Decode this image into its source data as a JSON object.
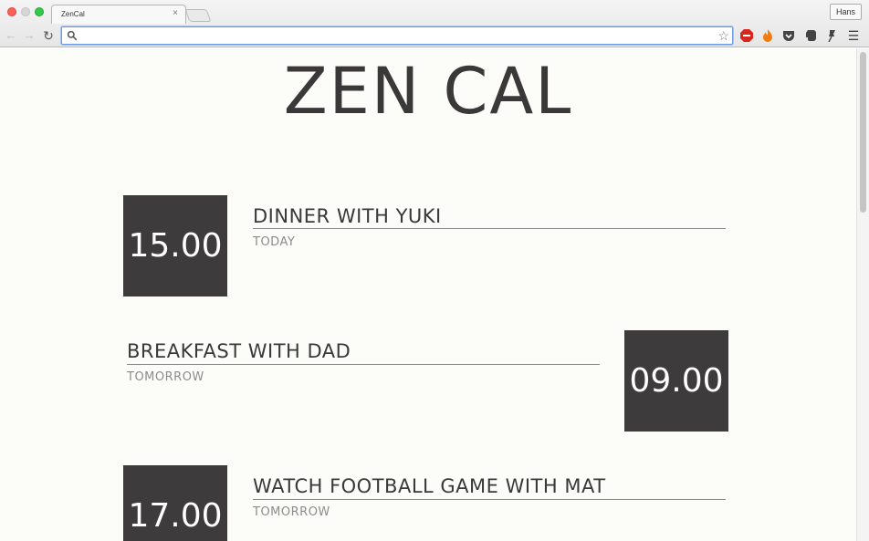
{
  "browser": {
    "tab_title": "ZenCal",
    "tab_close": "×",
    "profile_name": "Hans",
    "address": "",
    "extensions": [
      "adblock-icon",
      "fire-icon",
      "pocket-icon",
      "evernote-icon",
      "pin-icon",
      "menu-icon"
    ]
  },
  "page": {
    "title": "ZEN CAL",
    "events": [
      {
        "time": "15.00",
        "title": "DINNER WITH YUKI",
        "day": "TODAY"
      },
      {
        "time": "09.00",
        "title": "BREAKFAST WITH DAD",
        "day": "TOMORROW"
      },
      {
        "time": "17.00",
        "title": "WATCH FOOTBALL GAME WITH MAT",
        "day": "TOMORROW"
      }
    ]
  },
  "colors": {
    "background": "#fcfdf8",
    "box": "#3d3b3b",
    "text": "#3a3838",
    "muted": "#8c8c8c"
  }
}
